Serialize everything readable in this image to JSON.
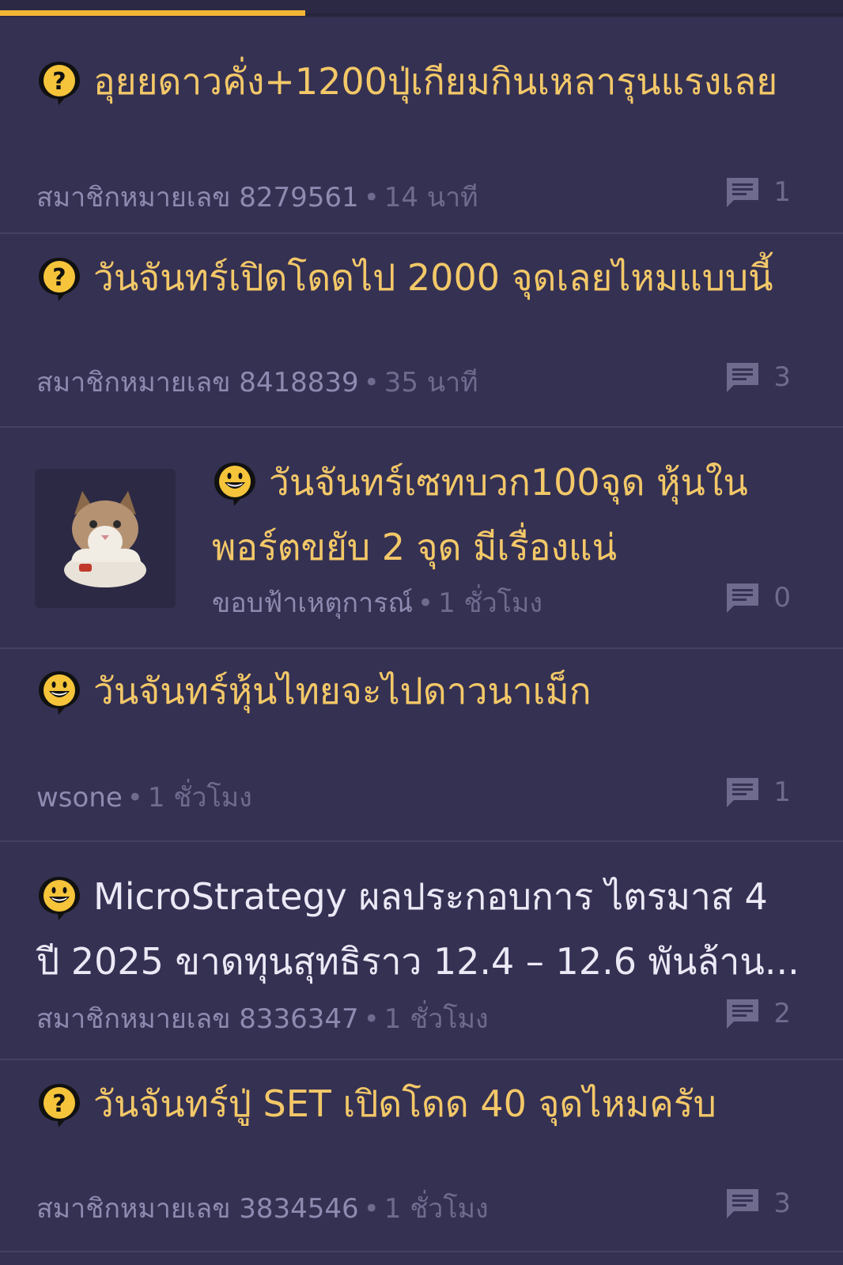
{
  "topics": [
    {
      "icon": "question-bubble-icon",
      "title": "อุยยดาวคั่ง+1200ปุ่เกียมกินเหลารุนแรงเลย",
      "author": "สมาชิกหมายเลข 8279561",
      "time": "14 นาที",
      "comments": "1"
    },
    {
      "icon": "question-bubble-icon",
      "title": "วันจันทร์เปิดโดดไป 2000 จุดเลยไหมแบบนี้",
      "author": "สมาชิกหมายเลข 8418839",
      "time": "35 นาที",
      "comments": "3"
    },
    {
      "icon": "smile-bubble-icon",
      "thumbnail": "cat-photo",
      "title": "วันจันทร์เซทบวก100จุด หุ้นในพอร์ตขยับ 2 จุด มีเรื่องแน่",
      "author": "ขอบฟ้าเหตุการณ์",
      "time": "1 ชั่วโมง",
      "comments": "0"
    },
    {
      "icon": "smile-bubble-icon",
      "title": "วันจันทร์หุ้นไทยจะไปดาวนาเม็ก",
      "author": "wsone",
      "time": "1 ชั่วโมง",
      "comments": "1"
    },
    {
      "icon": "smile-bubble-icon",
      "title_line1": "MicroStrategy ผลประกอบการ ไตรมาส 4",
      "title_line2": "ปี 2025 ขาดทุนสุทธิราว 12.4 – 12.6 พันล้าน...",
      "author": "สมาชิกหมายเลข 8336347",
      "time": "1 ชั่วโมง",
      "comments": "2"
    },
    {
      "icon": "question-bubble-icon",
      "title": "วันจันทร์ปู่ SET เปิดโดด 40 จุดไหมครับ",
      "author": "สมาชิกหมายเลข 3834546",
      "time": "1 ชั่วโมง",
      "comments": "3"
    }
  ],
  "meta_separator": "•",
  "colors": {
    "background": "#353153",
    "title_yellow": "#f3c868",
    "title_white": "#ece9f6",
    "accent_tab": "#f2b535",
    "meta_gray": "#8e8ab0"
  }
}
